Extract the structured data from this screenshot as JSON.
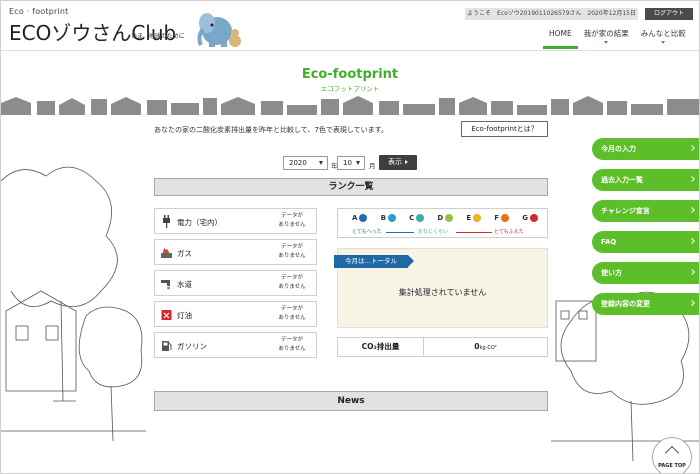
{
  "header": {
    "logo_small": "Eco · footprint",
    "logo_eco": "ECO",
    "logo_zou": "ゾウさん",
    "logo_club": "Club",
    "logo_tagline": "いま、地球のために",
    "welcome": "ようこそ　Ecoゾウ20190110265​79さん　2020年12月15日",
    "logout_label": "ログアウト",
    "nav": [
      {
        "label": "HOME",
        "active": true
      },
      {
        "label": "我が家の結果",
        "active": false
      },
      {
        "label": "みんなと比較",
        "active": false
      }
    ]
  },
  "page": {
    "title": "Eco-footprint",
    "subtitle": "エコフットプリント",
    "description": "あなたの家の二酸化炭素排出量を昨年と比較して、7色で表現しています。",
    "what_button": "Eco-footprintとは？",
    "year_value": "2020",
    "year_unit": "年",
    "month_value": "10",
    "month_unit": "月",
    "show_button": "表示"
  },
  "rank": {
    "heading": "ランク一覧",
    "energy_items": [
      {
        "label": "電力（宅内）",
        "value": "データが\nありません",
        "icon": "plug-icon"
      },
      {
        "label": "ガス",
        "value": "データが\nありません",
        "icon": "gas-flame-icon"
      },
      {
        "label": "水道",
        "value": "データが\nありません",
        "icon": "water-tap-icon"
      },
      {
        "label": "灯油",
        "value": "データが\nありません",
        "icon": "kerosene-can-icon"
      },
      {
        "label": "ガソリン",
        "value": "データが\nありません",
        "icon": "gas-pump-icon"
      }
    ],
    "grades": [
      {
        "letter": "A",
        "color": "#1e6db4"
      },
      {
        "letter": "B",
        "color": "#2b9bd6"
      },
      {
        "letter": "C",
        "color": "#35b0a8"
      },
      {
        "letter": "D",
        "color": "#8cc63f"
      },
      {
        "letter": "E",
        "color": "#f2b31b"
      },
      {
        "letter": "F",
        "color": "#e8701d"
      },
      {
        "letter": "G",
        "color": "#d9262b"
      }
    ],
    "scale_low": "とてもへった",
    "scale_mid": "おなじくらい",
    "scale_high": "とてもふえた",
    "total_tab": "今月は…トータル",
    "total_message": "集計処理されていません",
    "co2_label": "CO₂排出量",
    "co2_value": "0",
    "co2_unit": "kg-CO²"
  },
  "news": {
    "heading": "News"
  },
  "side_menu": [
    "今月の入力",
    "過去入力一覧",
    "チャレンジ宣言",
    "FAQ",
    "使い方",
    "登録内容の変更"
  ],
  "page_top_label": "PAGE TOP",
  "colors": {
    "brand_green": "#3fae29",
    "menu_green": "#5cbf2a",
    "tab_blue": "#1f6aa5"
  }
}
